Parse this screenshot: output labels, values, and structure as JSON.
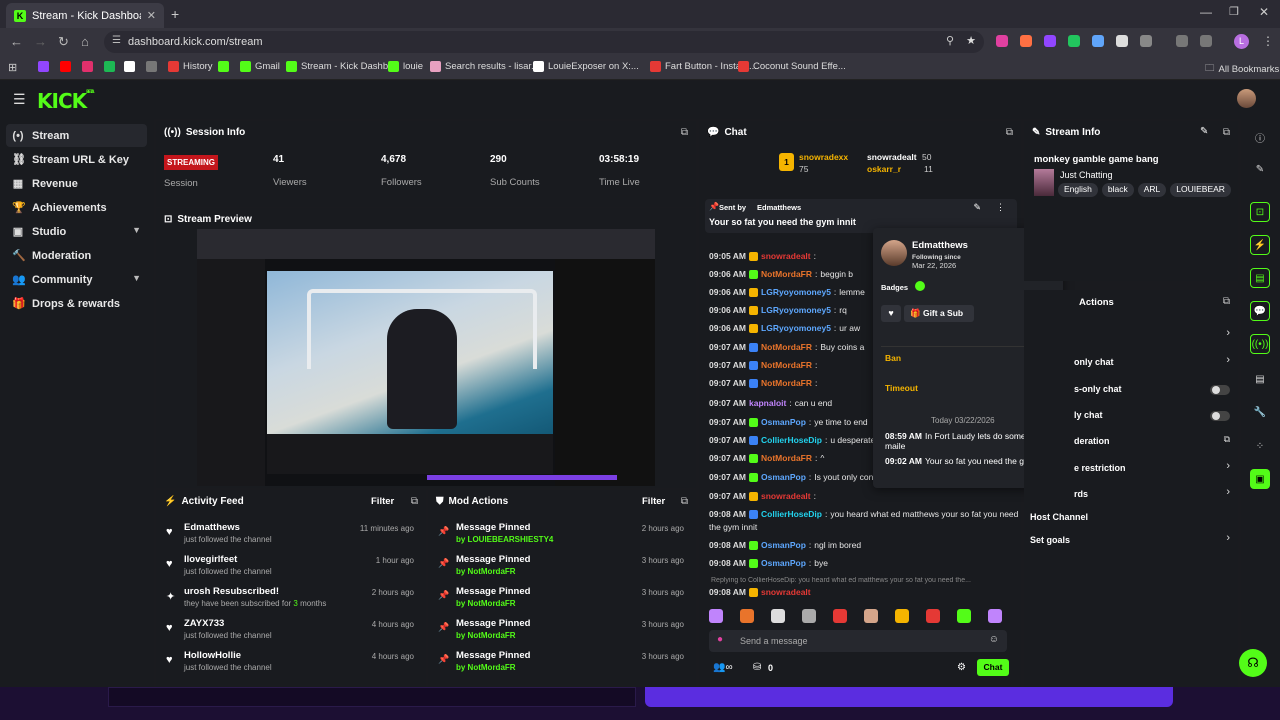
{
  "browser": {
    "tab_title": "Stream - Kick Dashboard",
    "url": "dashboard.kick.com/stream",
    "all_bookmarks": "All Bookmarks",
    "bookmarks": [
      {
        "label": "",
        "color": "#9146ff"
      },
      {
        "label": "",
        "color": "#ff0000"
      },
      {
        "label": "",
        "color": "#e1306c"
      },
      {
        "label": "",
        "color": "#1db954"
      },
      {
        "label": "",
        "color": "#ffffff"
      },
      {
        "label": "",
        "color": "#777777"
      },
      {
        "label": "History",
        "color": "#e53935"
      },
      {
        "label": "",
        "color": "#53fc18"
      },
      {
        "label": "Gmail",
        "color": "#53fc18"
      },
      {
        "label": "Stream - Kick Dashb...",
        "color": "#53fc18"
      },
      {
        "label": "louie",
        "color": "#53fc18"
      },
      {
        "label": "Search results - lisar...",
        "color": "#e8a0c0"
      },
      {
        "label": "LouieExposer on X:...",
        "color": "#ffffff"
      },
      {
        "label": "Fart Button - Instant...",
        "color": "#e53935"
      },
      {
        "label": "Coconut Sound Effe...",
        "color": "#e53935"
      }
    ]
  },
  "brand": {
    "logo": "KICK",
    "logo_sup": "BETA"
  },
  "sidebar": {
    "items": [
      {
        "label": "Stream",
        "icon": "(•)",
        "active": true
      },
      {
        "label": "Stream URL & Key",
        "icon": "⛓"
      },
      {
        "label": "Revenue",
        "icon": "▦"
      },
      {
        "label": "Achievements",
        "icon": "🏆"
      },
      {
        "label": "Studio",
        "icon": "▣",
        "expand": true
      },
      {
        "label": "Moderation",
        "icon": "🔨"
      },
      {
        "label": "Community",
        "icon": "👥",
        "expand": true
      },
      {
        "label": "Drops & rewards",
        "icon": "🎁"
      }
    ]
  },
  "session": {
    "title": "Session Info",
    "status": "STREAMING",
    "status_label": "Session",
    "viewers": "41",
    "viewers_label": "Viewers",
    "followers": "4,678",
    "followers_label": "Followers",
    "subs": "290",
    "subs_label": "Sub Counts",
    "time": "03:58:19",
    "time_label": "Time Live"
  },
  "preview": {
    "title": "Stream Preview"
  },
  "activity": {
    "title": "Activity Feed",
    "filter": "Filter",
    "rows": [
      {
        "name": "Edmatthews",
        "sub": "just followed the channel",
        "time": "11 minutes ago",
        "icon": "♥"
      },
      {
        "name": "Ilovegirlfeet",
        "sub": "just followed the channel",
        "time": "1 hour ago",
        "icon": "♥"
      },
      {
        "name": "urosh Resubscribed!",
        "sub_a": "they have been subscribed for ",
        "sub_b": "3",
        "sub_c": " months",
        "time": "2 hours ago",
        "icon": "✦"
      },
      {
        "name": "ZAYX733",
        "sub": "just followed the channel",
        "time": "4 hours ago",
        "icon": "♥"
      },
      {
        "name": "HollowHollie",
        "sub": "just followed the channel",
        "time": "4 hours ago",
        "icon": "♥"
      }
    ]
  },
  "mod": {
    "title": "Mod Actions",
    "filter": "Filter",
    "rows": [
      {
        "name": "Message Pinned",
        "sub": "by LOUIEBEARSHIESTY4",
        "time": "2 hours ago"
      },
      {
        "name": "Message Pinned",
        "sub": "by NotMordaFR",
        "time": "3 hours ago"
      },
      {
        "name": "Message Pinned",
        "sub": "by NotMordaFR",
        "time": "3 hours ago"
      },
      {
        "name": "Message Pinned",
        "sub": "by NotMordaFR",
        "time": "3 hours ago"
      },
      {
        "name": "Message Pinned",
        "sub": "by NotMordaFR",
        "time": "3 hours ago"
      }
    ]
  },
  "chat": {
    "title": "Chat",
    "top": {
      "rank": "1",
      "user1": "snowradexx",
      "user1_count": "75",
      "user2": "snowradealt",
      "user2_count": "50",
      "user3": "oskarr_r",
      "user3_count": "11"
    },
    "pinned": {
      "by_label": "Sent by",
      "by_user": "Edmatthews",
      "text": "Your so fat you need the gym innit"
    },
    "messages": [
      {
        "time": "09:05 AM",
        "user": "snowradealt",
        "color": "#e53935",
        "text": "",
        "badge": "#f5b400"
      },
      {
        "time": "09:06 AM",
        "user": "NotMordaFR",
        "color": "#e9742b",
        "text": "beggin b",
        "badge": "#53fc18"
      },
      {
        "time": "09:06 AM",
        "user": "LGRyoyomoney5",
        "color": "#5ea8ff",
        "text": "lemme",
        "badge": "#f5b400"
      },
      {
        "time": "09:06 AM",
        "user": "LGRyoyomoney5",
        "color": "#5ea8ff",
        "text": "rq",
        "badge": "#f5b400"
      },
      {
        "time": "09:06 AM",
        "user": "LGRyoyomoney5",
        "color": "#5ea8ff",
        "text": "ur aw",
        "badge": "#f5b400"
      },
      {
        "time": "09:07 AM",
        "user": "NotMordaFR",
        "color": "#e9742b",
        "text": "Buy coins a",
        "badge": "#3b82f6"
      },
      {
        "time": "09:07 AM",
        "user": "NotMordaFR",
        "color": "#e9742b",
        "text": "",
        "badge": "#3b82f6"
      },
      {
        "time": "09:07 AM",
        "user": "NotMordaFR",
        "color": "#e9742b",
        "text": "",
        "badge": "#3b82f6"
      },
      {
        "time": "09:07 AM",
        "user": "kapnaloit",
        "color": "#c084fc",
        "text": "can u end",
        "badge": ""
      },
      {
        "time": "09:07 AM",
        "user": "OsmanPop",
        "color": "#5ea8ff",
        "text": "ye time to end",
        "badge": "#53fc18"
      },
      {
        "time": "09:07 AM",
        "user": "CollierHoseDip",
        "color": "#22d3ee",
        "text": "u desperate",
        "badge": "#3b82f6"
      },
      {
        "time": "09:07 AM",
        "user": "NotMordaFR",
        "color": "#e9742b",
        "text": "^",
        "badge": "#53fc18"
      },
      {
        "time": "09:07 AM",
        "user": "OsmanPop",
        "color": "#5ea8ff",
        "text": "Is yout only con",
        "badge": "#53fc18"
      },
      {
        "time": "09:07 AM",
        "user": "snowradealt",
        "color": "#e53935",
        "text": "",
        "badge": "#f5b400"
      },
      {
        "time": "09:08 AM",
        "user": "CollierHoseDip",
        "color": "#22d3ee",
        "text": "you heard what ed matthews your so fat you need",
        "badge": "#3b82f6"
      },
      {
        "time": "09:08 AM",
        "user": "OsmanPop",
        "color": "#5ea8ff",
        "text": "ngl im bored",
        "badge": "#53fc18"
      },
      {
        "time": "09:08 AM",
        "user": "OsmanPop",
        "color": "#5ea8ff",
        "text": "bye",
        "badge": "#53fc18"
      }
    ],
    "wrap_line": "the gym innit",
    "reply_line": "Replying to CollierHoseDip: you heard what ed matthews your so fat you need the...",
    "last": {
      "time": "09:08 AM",
      "user": "snowradealt"
    },
    "input_placeholder": "Send a message",
    "send_label": "Chat",
    "points": "0"
  },
  "user_card": {
    "name": "Edmatthews",
    "following_label": "Following since",
    "following_date": "Mar 22, 2026",
    "badges_label": "Badges",
    "gift_label": "Gift a Sub",
    "ban_label": "Ban",
    "timeout_label": "Timeout",
    "date_header": "Today 03/22/2026",
    "history": [
      {
        "time": "08:59 AM",
        "text": "In Fort Laudy lets do something maile"
      },
      {
        "time": "09:02 AM",
        "text": "Your so fat you need the gym innit"
      }
    ]
  },
  "stream_info": {
    "title": "Stream Info",
    "stream_title": "monkey gamble game bang",
    "category": "Just Chatting",
    "tags": [
      "English",
      "black",
      "ARL",
      "LOUIEBEAR"
    ]
  },
  "actions": {
    "title": "Actions",
    "rows": [
      {
        "label": "",
        "type": "chevron"
      },
      {
        "label": "only chat",
        "type": "chevron"
      },
      {
        "label": "s-only chat",
        "type": "toggle"
      },
      {
        "label": "ly chat",
        "type": "toggle"
      },
      {
        "label": "deration",
        "type": "link"
      },
      {
        "label": "e restriction",
        "type": "chevron"
      },
      {
        "label": "rds",
        "type": "chevron"
      },
      {
        "label": "Host Channel",
        "type": "none"
      },
      {
        "label": "Set goals",
        "type": "chevron"
      }
    ]
  },
  "colors": {
    "accent": "#53fc18",
    "live": "#c4161c",
    "panel": "#191b1f",
    "bg": "#0e0f12"
  }
}
